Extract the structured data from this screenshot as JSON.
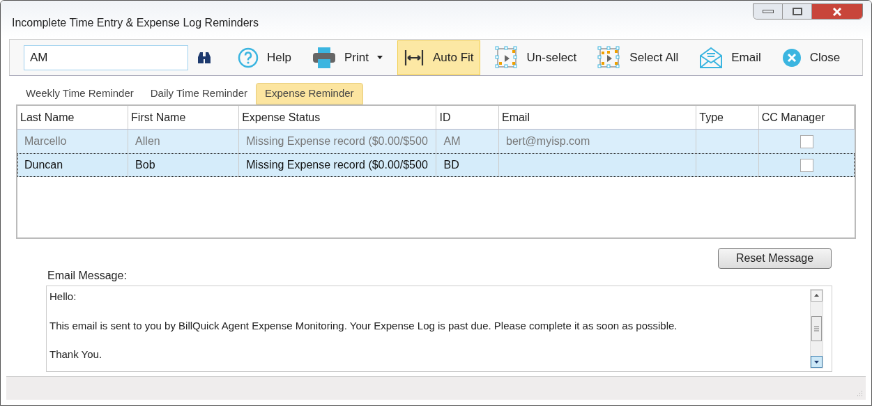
{
  "window": {
    "title": "Incomplete Time Entry & Expense Log Reminders"
  },
  "toolbar": {
    "search": {
      "value": "AM"
    },
    "buttons": [
      {
        "kind": "help",
        "label": "Help",
        "active": false,
        "menu": false
      },
      {
        "kind": "print",
        "label": "Print",
        "active": false,
        "menu": true
      },
      {
        "kind": "autofit",
        "label": "Auto Fit",
        "active": true,
        "menu": false
      },
      {
        "kind": "unselect",
        "label": "Un-select",
        "active": false,
        "menu": false
      },
      {
        "kind": "selectall",
        "label": "Select All",
        "active": false,
        "menu": false
      },
      {
        "kind": "email",
        "label": "Email",
        "active": false,
        "menu": false
      },
      {
        "kind": "close",
        "label": "Close",
        "active": false,
        "menu": false
      }
    ]
  },
  "tabs": [
    {
      "label": "Weekly Time Reminder",
      "selected": false
    },
    {
      "label": "Daily Time Reminder",
      "selected": false
    },
    {
      "label": "Expense Reminder",
      "selected": true
    }
  ],
  "table": {
    "columns": [
      "Last Name",
      "First Name",
      "Expense Status",
      "ID",
      "Email",
      "Type",
      "CC Manager"
    ],
    "rows": [
      {
        "cells": [
          "Marcello",
          "Allen",
          "Missing Expense record ($0.00/$500",
          "AM",
          "bert@myisp.com",
          ""
        ],
        "cc_manager": false,
        "focused": false
      },
      {
        "cells": [
          "Duncan",
          "Bob",
          "Missing Expense record ($0.00/$500",
          "BD",
          "",
          ""
        ],
        "cc_manager": false,
        "focused": true
      }
    ]
  },
  "reset_button": "Reset Message",
  "email_message": {
    "label": "Email Message:",
    "paragraphs": [
      "Hello:",
      "This email is sent to you by BillQuick Agent Expense Monitoring. Your Expense Log is past due. Please complete it as soon as possible.",
      "Thank You."
    ]
  }
}
